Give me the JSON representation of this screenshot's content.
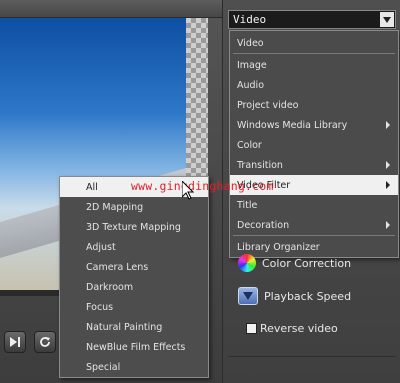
{
  "category_select": {
    "value": "Video",
    "arrow_icon": "chevron-down-icon"
  },
  "category_dropdown": {
    "items": [
      {
        "label": "Video",
        "has_submenu": false
      },
      {
        "label": "Image",
        "has_submenu": false
      },
      {
        "label": "Audio",
        "has_submenu": false
      },
      {
        "label": "Project video",
        "has_submenu": false
      },
      {
        "label": "Windows Media Library",
        "has_submenu": true
      },
      {
        "label": "Color",
        "has_submenu": false
      },
      {
        "label": "Transition",
        "has_submenu": true
      },
      {
        "label": "Video Filter",
        "has_submenu": true
      },
      {
        "label": "Title",
        "has_submenu": false
      },
      {
        "label": "Decoration",
        "has_submenu": true
      },
      {
        "label": "Library Organizer",
        "has_submenu": false
      }
    ],
    "selected": "Video Filter"
  },
  "video_filter_submenu": {
    "items": [
      {
        "label": "All"
      },
      {
        "label": "2D Mapping"
      },
      {
        "label": "3D Texture Mapping"
      },
      {
        "label": "Adjust"
      },
      {
        "label": "Camera Lens"
      },
      {
        "label": "Darkroom"
      },
      {
        "label": "Focus"
      },
      {
        "label": "Natural Painting"
      },
      {
        "label": "NewBlue Film Effects"
      },
      {
        "label": "Special"
      }
    ],
    "selected": "All"
  },
  "options": {
    "color_correction": "Color Correction",
    "playback_speed": "Playback Speed",
    "reverse_video": "Reverse video",
    "reverse_video_checked": false
  },
  "transport": {
    "next_icon": "skip-next-icon",
    "repeat_icon": "repeat-icon"
  },
  "watermark": "www.gingdinghang.com",
  "colors": {
    "panel_bg": "#4a4a4a",
    "highlight_bg": "#f0f0f0",
    "watermark": "#e0202a"
  }
}
